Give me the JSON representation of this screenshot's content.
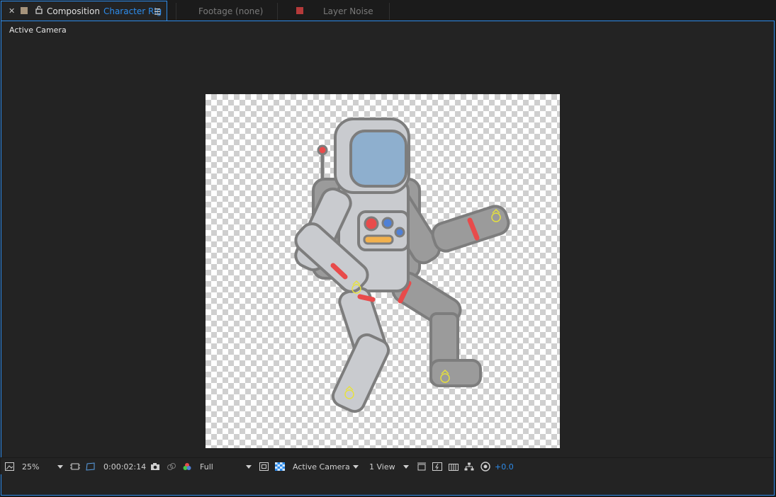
{
  "tabs": [
    {
      "kind": "composition",
      "prefix": "Composition",
      "name": "Character Rig",
      "active": true,
      "swatch": "#a6937b",
      "accent": "#2d8ceb"
    },
    {
      "kind": "footage",
      "label": "Footage",
      "suffix": "(none)",
      "active": false
    },
    {
      "kind": "layer",
      "label": "Layer",
      "name": "Noise",
      "active": false,
      "swatch": "#b53a3a"
    }
  ],
  "viewer": {
    "label": "Active Camera"
  },
  "icons": [
    "close-icon",
    "lock-icon",
    "panel-menu-icon",
    "snapshot-icon",
    "show-snapshot-icon",
    "channel-icon",
    "resolution-dropdown-icon",
    "region-of-interest-icon",
    "transparency-grid-icon",
    "camera-dropdown-icon",
    "view-layout-icon",
    "toggle-pixel-aspect-icon",
    "fast-preview-icon",
    "timeline-icon",
    "flowchart-icon",
    "reset-exposure-icon"
  ],
  "bottombar": {
    "magnification": "25%",
    "timecode": "0:00:02:14",
    "resolution": "Full",
    "camera": "Active Camera",
    "view_layout": "1 View",
    "exposure": "+0.0"
  },
  "colors": {
    "accent": "#2d8ceb",
    "panel": "#232323",
    "suit": "#c9cbcf",
    "suit_dark": "#9b9b9b",
    "outline": "#7d7d7d",
    "visor": "#8eafce",
    "stripe": "#e84b4b",
    "handle": "#e8e23a"
  }
}
